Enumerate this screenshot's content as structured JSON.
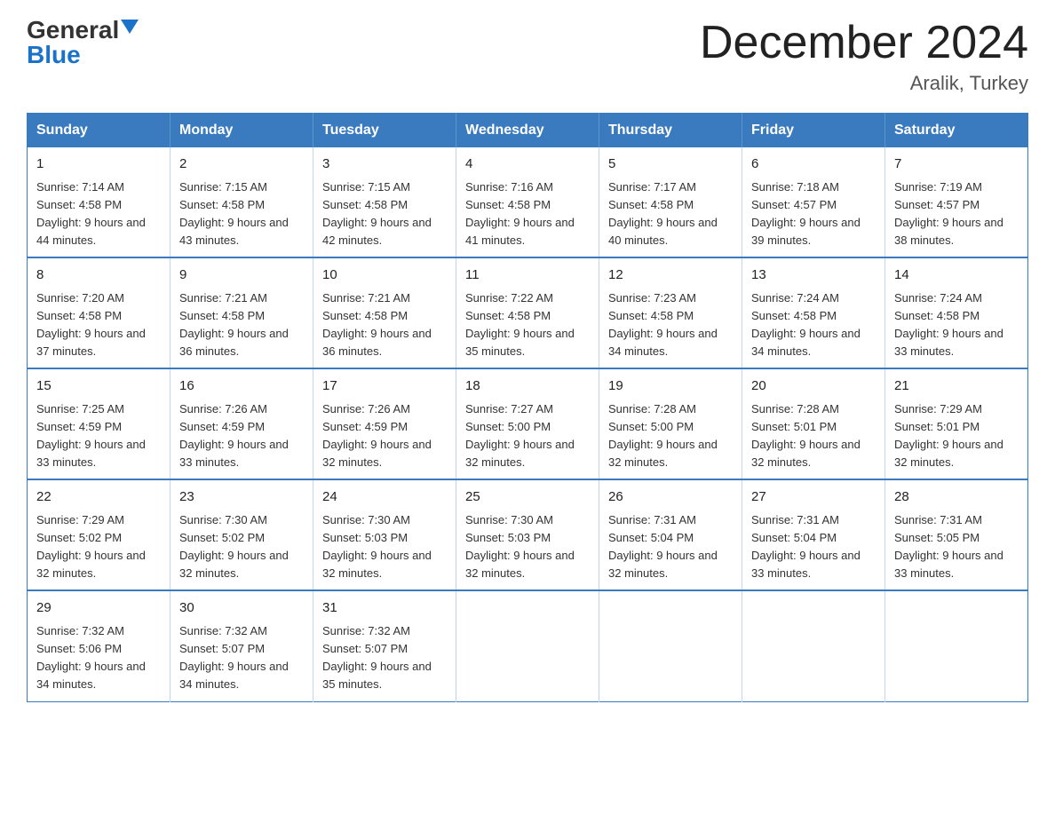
{
  "logo": {
    "general": "General",
    "blue": "Blue"
  },
  "title": "December 2024",
  "subtitle": "Aralik, Turkey",
  "weekdays": [
    "Sunday",
    "Monday",
    "Tuesday",
    "Wednesday",
    "Thursday",
    "Friday",
    "Saturday"
  ],
  "weeks": [
    [
      {
        "day": "1",
        "sunrise": "7:14 AM",
        "sunset": "4:58 PM",
        "daylight": "9 hours and 44 minutes."
      },
      {
        "day": "2",
        "sunrise": "7:15 AM",
        "sunset": "4:58 PM",
        "daylight": "9 hours and 43 minutes."
      },
      {
        "day": "3",
        "sunrise": "7:15 AM",
        "sunset": "4:58 PM",
        "daylight": "9 hours and 42 minutes."
      },
      {
        "day": "4",
        "sunrise": "7:16 AM",
        "sunset": "4:58 PM",
        "daylight": "9 hours and 41 minutes."
      },
      {
        "day": "5",
        "sunrise": "7:17 AM",
        "sunset": "4:58 PM",
        "daylight": "9 hours and 40 minutes."
      },
      {
        "day": "6",
        "sunrise": "7:18 AM",
        "sunset": "4:57 PM",
        "daylight": "9 hours and 39 minutes."
      },
      {
        "day": "7",
        "sunrise": "7:19 AM",
        "sunset": "4:57 PM",
        "daylight": "9 hours and 38 minutes."
      }
    ],
    [
      {
        "day": "8",
        "sunrise": "7:20 AM",
        "sunset": "4:58 PM",
        "daylight": "9 hours and 37 minutes."
      },
      {
        "day": "9",
        "sunrise": "7:21 AM",
        "sunset": "4:58 PM",
        "daylight": "9 hours and 36 minutes."
      },
      {
        "day": "10",
        "sunrise": "7:21 AM",
        "sunset": "4:58 PM",
        "daylight": "9 hours and 36 minutes."
      },
      {
        "day": "11",
        "sunrise": "7:22 AM",
        "sunset": "4:58 PM",
        "daylight": "9 hours and 35 minutes."
      },
      {
        "day": "12",
        "sunrise": "7:23 AM",
        "sunset": "4:58 PM",
        "daylight": "9 hours and 34 minutes."
      },
      {
        "day": "13",
        "sunrise": "7:24 AM",
        "sunset": "4:58 PM",
        "daylight": "9 hours and 34 minutes."
      },
      {
        "day": "14",
        "sunrise": "7:24 AM",
        "sunset": "4:58 PM",
        "daylight": "9 hours and 33 minutes."
      }
    ],
    [
      {
        "day": "15",
        "sunrise": "7:25 AM",
        "sunset": "4:59 PM",
        "daylight": "9 hours and 33 minutes."
      },
      {
        "day": "16",
        "sunrise": "7:26 AM",
        "sunset": "4:59 PM",
        "daylight": "9 hours and 33 minutes."
      },
      {
        "day": "17",
        "sunrise": "7:26 AM",
        "sunset": "4:59 PM",
        "daylight": "9 hours and 32 minutes."
      },
      {
        "day": "18",
        "sunrise": "7:27 AM",
        "sunset": "5:00 PM",
        "daylight": "9 hours and 32 minutes."
      },
      {
        "day": "19",
        "sunrise": "7:28 AM",
        "sunset": "5:00 PM",
        "daylight": "9 hours and 32 minutes."
      },
      {
        "day": "20",
        "sunrise": "7:28 AM",
        "sunset": "5:01 PM",
        "daylight": "9 hours and 32 minutes."
      },
      {
        "day": "21",
        "sunrise": "7:29 AM",
        "sunset": "5:01 PM",
        "daylight": "9 hours and 32 minutes."
      }
    ],
    [
      {
        "day": "22",
        "sunrise": "7:29 AM",
        "sunset": "5:02 PM",
        "daylight": "9 hours and 32 minutes."
      },
      {
        "day": "23",
        "sunrise": "7:30 AM",
        "sunset": "5:02 PM",
        "daylight": "9 hours and 32 minutes."
      },
      {
        "day": "24",
        "sunrise": "7:30 AM",
        "sunset": "5:03 PM",
        "daylight": "9 hours and 32 minutes."
      },
      {
        "day": "25",
        "sunrise": "7:30 AM",
        "sunset": "5:03 PM",
        "daylight": "9 hours and 32 minutes."
      },
      {
        "day": "26",
        "sunrise": "7:31 AM",
        "sunset": "5:04 PM",
        "daylight": "9 hours and 32 minutes."
      },
      {
        "day": "27",
        "sunrise": "7:31 AM",
        "sunset": "5:04 PM",
        "daylight": "9 hours and 33 minutes."
      },
      {
        "day": "28",
        "sunrise": "7:31 AM",
        "sunset": "5:05 PM",
        "daylight": "9 hours and 33 minutes."
      }
    ],
    [
      {
        "day": "29",
        "sunrise": "7:32 AM",
        "sunset": "5:06 PM",
        "daylight": "9 hours and 34 minutes."
      },
      {
        "day": "30",
        "sunrise": "7:32 AM",
        "sunset": "5:07 PM",
        "daylight": "9 hours and 34 minutes."
      },
      {
        "day": "31",
        "sunrise": "7:32 AM",
        "sunset": "5:07 PM",
        "daylight": "9 hours and 35 minutes."
      },
      null,
      null,
      null,
      null
    ]
  ]
}
